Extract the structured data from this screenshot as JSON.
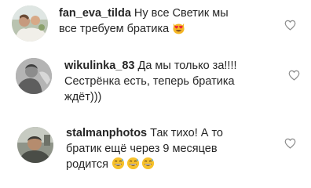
{
  "comments": [
    {
      "username": "fan_eva_tilda",
      "lines": [
        "Ну все Светик мы",
        "все требуем братика"
      ],
      "avatar_icon": "user-avatar-photo",
      "emoji": [
        "smiling-cat-heart-eyes-emoji"
      ],
      "like_icon": "heart-outline-icon"
    },
    {
      "username": "wikulinka_83",
      "lines": [
        "Да мы только за!!!!",
        "Сестрёнка есть, теперь братика",
        "ждёт)))"
      ],
      "avatar_icon": "user-avatar-photo",
      "like_icon": "heart-outline-icon"
    },
    {
      "username": "stalmanphotos",
      "lines": [
        "Так тихо! А то",
        "братик ещё через 9 месяцев",
        "родится"
      ],
      "avatar_icon": "user-avatar-photo",
      "emoji": [
        "grinning-sweat-emoji",
        "grinning-sweat-emoji",
        "grinning-sweat-emoji"
      ],
      "like_icon": "heart-outline-icon"
    }
  ],
  "colors": {
    "text": "#262626",
    "heart_stroke": "#8e8e8e",
    "emoji_face": "#f7c12a",
    "cat_face": "#f5b625",
    "heart_eyes": "#e8213a"
  }
}
